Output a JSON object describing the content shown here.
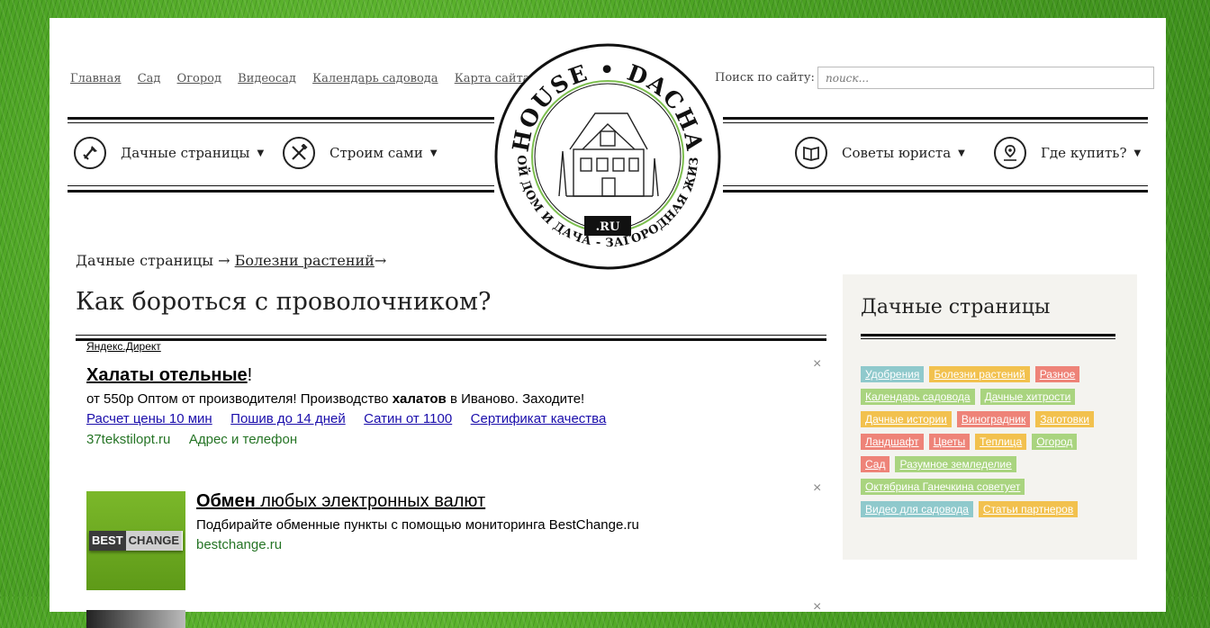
{
  "top_nav": {
    "links": [
      "Главная",
      "Сад",
      "Огород",
      "Видеосад",
      "Календарь садовода",
      "Карта сайта"
    ]
  },
  "search": {
    "label": "Поиск по сайту:",
    "placeholder": "поиск..."
  },
  "menu": {
    "left": [
      {
        "label": "Дачные страницы",
        "icon": "shovel-rake-icon"
      },
      {
        "label": "Строим сами",
        "icon": "hammer-wrench-icon"
      }
    ],
    "right": [
      {
        "label": "Советы юриста",
        "icon": "book-icon"
      },
      {
        "label": "Где купить?",
        "icon": "map-pin-icon"
      }
    ],
    "caret": "▼"
  },
  "logo": {
    "top_text": "HOUSE • DACHA",
    "bottom_text": "СВОЙ ДОМ И ДАЧА - ЗАГОРОДНАЯ ЖИЗНЬ",
    "badge": ".RU"
  },
  "breadcrumb": {
    "root": "Дачные страницы",
    "section": "Болезни растений",
    "arrow": "→"
  },
  "page_title": "Как бороться с проволочником?",
  "ads": {
    "label": "Яндекс.Директ",
    "close": "×",
    "ad1": {
      "title_bold": "Халаты отельные",
      "title_rest": "!",
      "text_before": "от 550р Оптом от производителя! Производство ",
      "text_bold": "халатов",
      "text_after": " в Иваново. Заходите!",
      "links": [
        "Расчет цены 10 мин",
        "Пошив до 14 дней",
        "Сатин от 1100",
        "Сертификат качества"
      ],
      "domain": "37tekstilopt.ru",
      "contact": "Адрес и телефон"
    },
    "ad2": {
      "title_bold": "Обмен",
      "title_rest": " любых электронных валют",
      "text": "Подбирайте обменные пункты с помощью мониторинга BestChange.ru",
      "domain": "bestchange.ru",
      "logo_left": "BEST",
      "logo_right": "CHANGE"
    }
  },
  "sidebar": {
    "title": "Дачные страницы",
    "tags": [
      {
        "label": "Удобрения",
        "color": "#8fc9cc"
      },
      {
        "label": "Болезни растений",
        "color": "#f2c14e"
      },
      {
        "label": "Разное",
        "color": "#ee8378"
      },
      {
        "label": "Календарь садовода",
        "color": "#a9d47f"
      },
      {
        "label": "Дачные хитрости",
        "color": "#a9d47f"
      },
      {
        "label": "Дачные истории",
        "color": "#f2c14e"
      },
      {
        "label": "Виноградник",
        "color": "#ee8378"
      },
      {
        "label": "Заготовки",
        "color": "#f2c14e"
      },
      {
        "label": "Ландшафт",
        "color": "#ee8378"
      },
      {
        "label": "Цветы",
        "color": "#ee8378"
      },
      {
        "label": "Теплица",
        "color": "#f2c14e"
      },
      {
        "label": "Огород",
        "color": "#a9d47f"
      },
      {
        "label": "Сад",
        "color": "#ee8378"
      },
      {
        "label": "Разумное земледелие",
        "color": "#a9d47f"
      },
      {
        "label": "Октябрина Ганечкина советует",
        "color": "#a9d47f"
      },
      {
        "label": "Видео для садовода",
        "color": "#8fc9cc"
      },
      {
        "label": "Статьи партнеров",
        "color": "#f2c14e"
      }
    ]
  }
}
